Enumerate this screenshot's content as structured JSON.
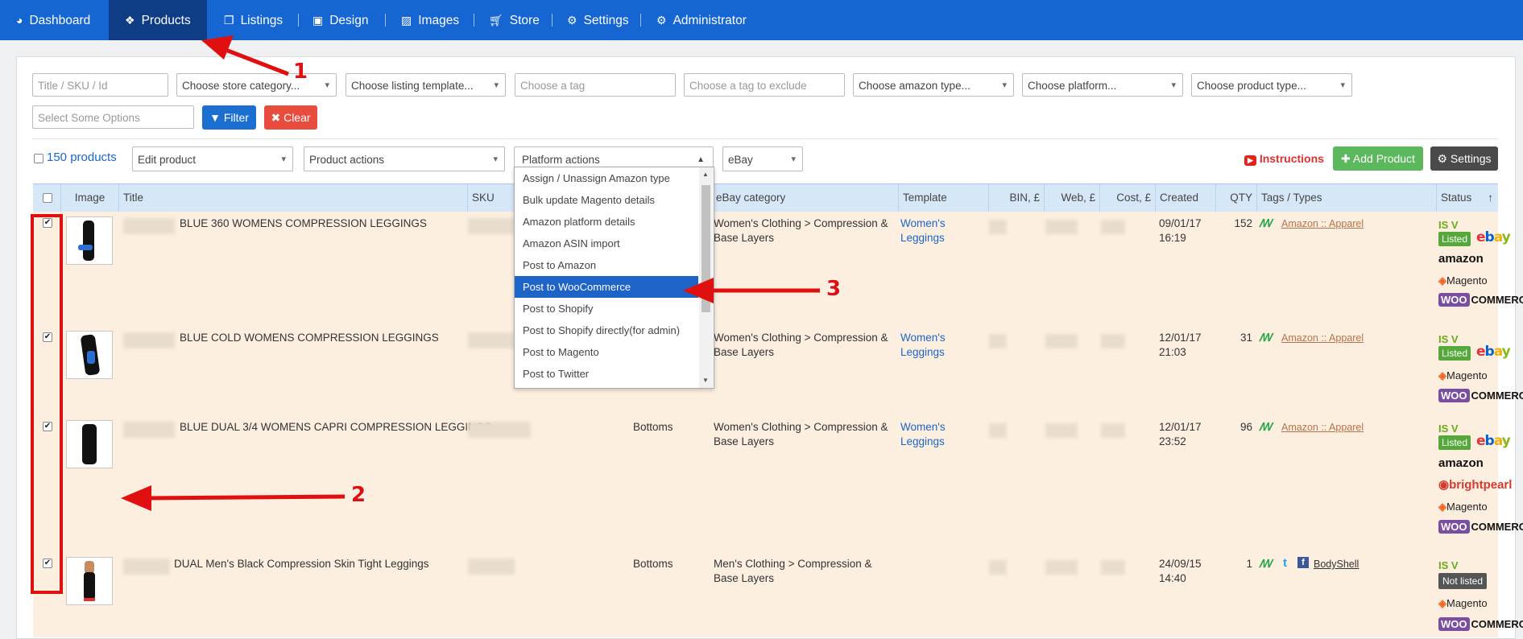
{
  "nav": {
    "items": [
      {
        "label": "Dashboard",
        "icon": "dashboard-icon"
      },
      {
        "label": "Products",
        "icon": "cubes-icon"
      },
      {
        "label": "Listings",
        "icon": "copy-icon"
      },
      {
        "label": "Design",
        "icon": "layout-icon"
      },
      {
        "label": "Images",
        "icon": "image-icon"
      },
      {
        "label": "Store",
        "icon": "cart-icon"
      },
      {
        "label": "Settings",
        "icon": "gear-icon"
      },
      {
        "label": "Administrator",
        "icon": "gear-icon"
      }
    ]
  },
  "filters": {
    "title_sku_placeholder": "Title / SKU / Id",
    "store_category": "Choose store category...",
    "listing_template": "Choose listing template...",
    "tag_placeholder": "Choose a tag",
    "exclude_tag_placeholder": "Choose a tag to exclude",
    "amazon_type": "Choose amazon type...",
    "platform": "Choose platform...",
    "product_type": "Choose product type...",
    "options_placeholder": "Select Some Options",
    "filter_label": "Filter",
    "clear_label": "Clear"
  },
  "toolbar": {
    "product_count": "150 products",
    "edit_product": "Edit product",
    "product_actions": "Product actions",
    "platform_actions": "Platform actions",
    "platform_select": "eBay",
    "instructions": "Instructions",
    "add_product": "Add Product",
    "settings": "Settings"
  },
  "platform_menu": {
    "items": [
      "Assign / Unassign Amazon type",
      "Bulk update Magento details",
      "Amazon platform details",
      "Amazon ASIN import",
      "Post to Amazon",
      "Post to WooCommerce",
      "Post to Shopify",
      "Post to Shopify directly(for admin)",
      "Post to Magento",
      "Post to Twitter"
    ],
    "highlighted": "Post to WooCommerce"
  },
  "table": {
    "columns": [
      "Image",
      "Title",
      "SKU",
      "eBay category",
      "Template",
      "BIN, £",
      "Web, £",
      "Cost, £",
      "Created",
      "QTY",
      "Tags / Types",
      "Status"
    ],
    "sort_icon": "↑",
    "rows": [
      {
        "title": "BLUE 360 WOMENS COMPRESSION LEGGINGS",
        "type": "",
        "category": "Women's Clothing > Compression & Base Layers",
        "template": "Women's Leggings",
        "created_date": "09/01/17",
        "created_time": "16:19",
        "qty": "152",
        "tag": "Amazon :: Apparel",
        "status": "Listed"
      },
      {
        "title": "BLUE COLD WOMENS COMPRESSION LEGGINGS",
        "type": "",
        "category": "Women's Clothing > Compression & Base Layers",
        "template": "Women's Leggings",
        "created_date": "12/01/17",
        "created_time": "21:03",
        "qty": "31",
        "tag": "Amazon :: Apparel",
        "status": "Listed"
      },
      {
        "title": "BLUE DUAL 3/4 WOMENS CAPRI COMPRESSION LEGGINGS",
        "type": "Bottoms",
        "category": "Women's Clothing > Compression & Base Layers",
        "template": "Women's Leggings",
        "created_date": "12/01/17",
        "created_time": "23:52",
        "qty": "96",
        "tag": "Amazon :: Apparel",
        "status": "Listed"
      },
      {
        "title": "DUAL Men's Black Compression Skin Tight Leggings",
        "type": "Bottoms",
        "category": "Men's Clothing > Compression & Base Layers",
        "template": "",
        "created_date": "24/09/15",
        "created_time": "14:40",
        "qty": "1",
        "tag": "BodyShell",
        "status": "Not listed"
      }
    ],
    "status_prefix": "IS  V",
    "platforms": {
      "ebay": "ebay",
      "amazon": "amazon",
      "magento": "Magento",
      "woo": "COMMERCE",
      "woo_badge": "WOO",
      "brightpearl": "brightpearl"
    }
  },
  "annotations": [
    "1",
    "2",
    "3"
  ],
  "colors": {
    "nav": "#1566d2",
    "nav_active": "#0e3d86",
    "filter": "#1a6fd1",
    "clear": "#e74c3c",
    "add": "#5cb85c",
    "row": "#fdefe0",
    "header": "#d6e7f8",
    "arrow": "#e01010"
  }
}
